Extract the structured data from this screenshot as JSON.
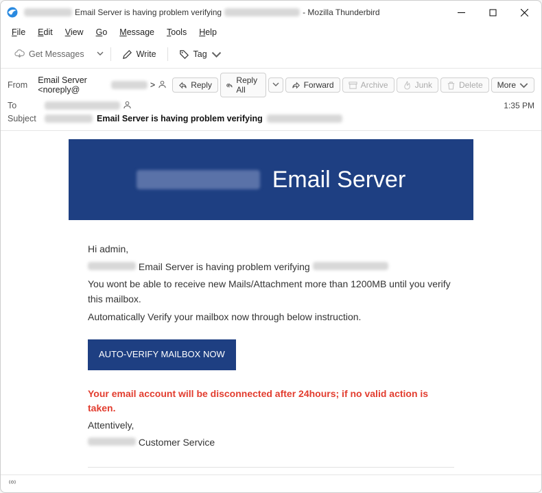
{
  "window": {
    "title_prefix": "Email Server is having problem verifying",
    "title_suffix": "- Mozilla Thunderbird"
  },
  "menu": {
    "file": "File",
    "edit": "Edit",
    "view": "View",
    "go": "Go",
    "message": "Message",
    "tools": "Tools",
    "help": "Help"
  },
  "toolbar": {
    "get_messages": "Get Messages",
    "write": "Write",
    "tag": "Tag"
  },
  "actions": {
    "reply": "Reply",
    "reply_all": "Reply All",
    "forward": "Forward",
    "archive": "Archive",
    "junk": "Junk",
    "delete": "Delete",
    "more": "More"
  },
  "header": {
    "from_label": "From",
    "from_value": "Email Server <noreply@",
    "from_close": ">",
    "to_label": "To",
    "subject_label": "Subject",
    "subject_bold": "Email Server is having problem verifying",
    "time": "1:35 PM"
  },
  "email": {
    "banner_title": "Email Server",
    "greeting": "Hi admin,",
    "line1_mid": " Email Server is having problem verifying ",
    "line2": "You wont be able to receive new Mails/Attachment more than 1200MB until you verify this mailbox.",
    "line3": "Automatically Verify your mailbox now through below instruction.",
    "button": "AUTO-VERIFY MAILBOX NOW",
    "warning": "Your email account will be disconnected after 24hours; if no valid action is taken.",
    "sig1": "Attentively,",
    "sig2_suffix": " Customer Service"
  }
}
